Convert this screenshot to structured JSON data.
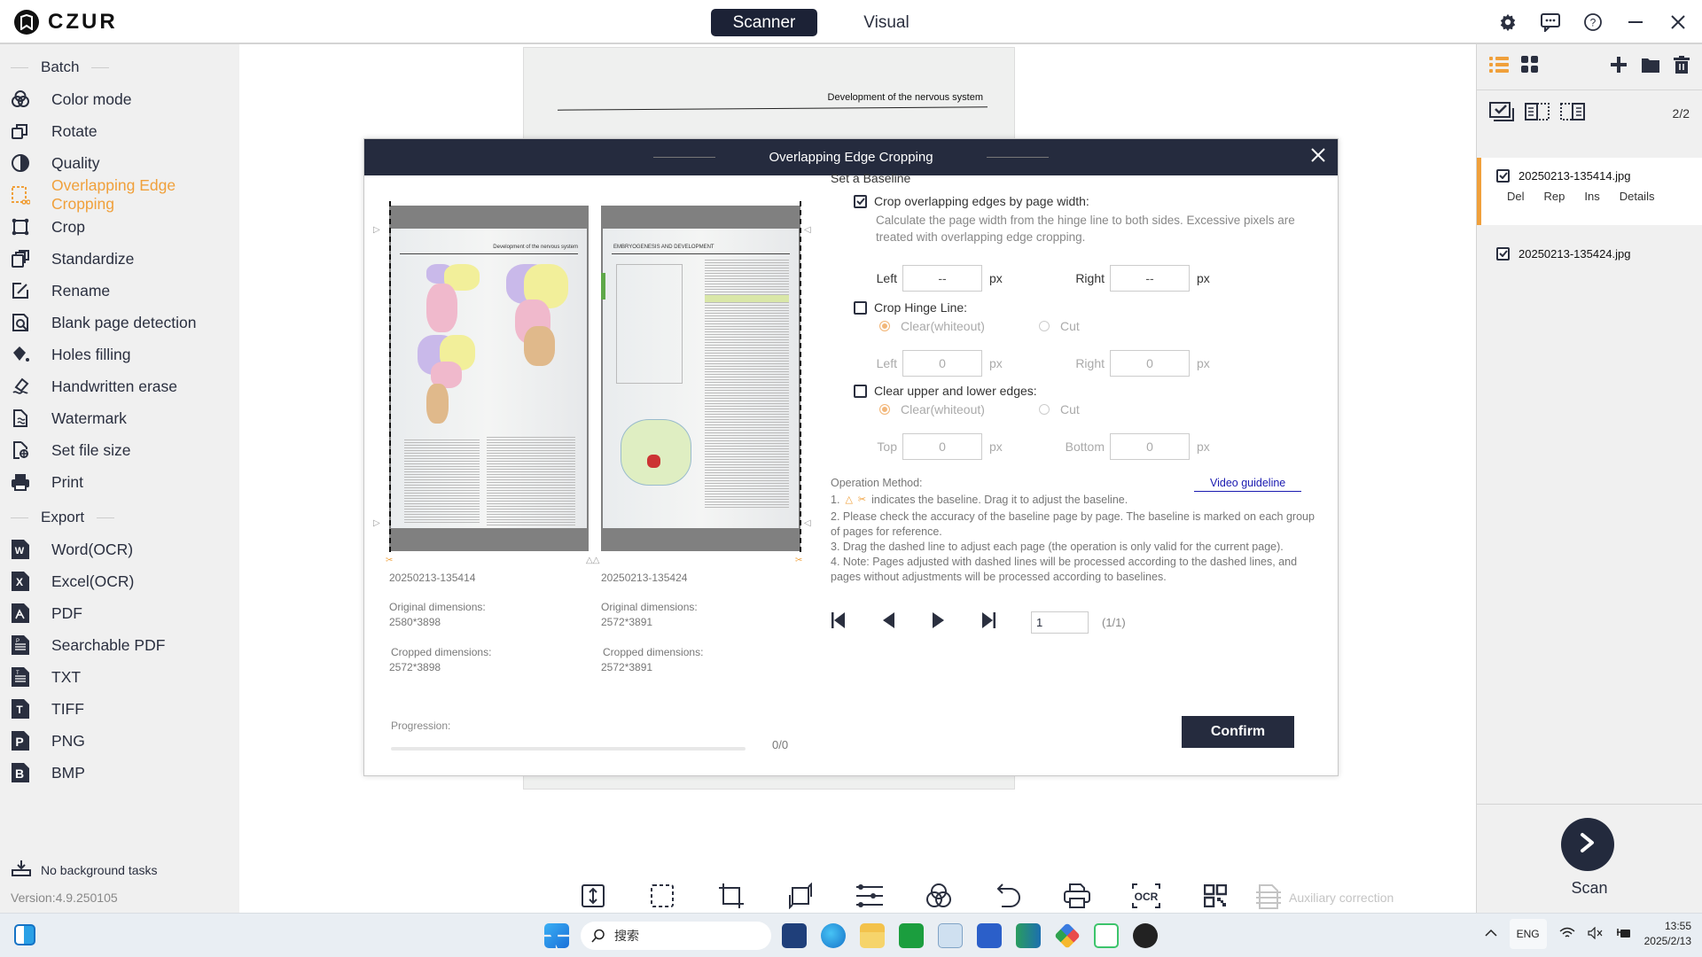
{
  "app": {
    "name": "CZUR"
  },
  "mode_tabs": [
    {
      "label": "Scanner",
      "active": true
    },
    {
      "label": "Visual",
      "active": false
    }
  ],
  "window_controls": [
    "settings-icon",
    "feedback-icon",
    "help-icon",
    "minimize-icon",
    "close-icon"
  ],
  "sidebar": {
    "batch_title": "Batch",
    "batch_items": [
      {
        "label": "Color mode",
        "icon": "color-mode-icon"
      },
      {
        "label": "Rotate",
        "icon": "rotate-icon"
      },
      {
        "label": "Quality",
        "icon": "quality-icon"
      },
      {
        "label": "Overlapping Edge Cropping",
        "icon": "overlapping-crop-icon",
        "active": true
      },
      {
        "label": "Crop",
        "icon": "crop-icon"
      },
      {
        "label": "Standardize",
        "icon": "standardize-icon"
      },
      {
        "label": "Rename",
        "icon": "rename-icon"
      },
      {
        "label": "Blank page detection",
        "icon": "blank-page-icon"
      },
      {
        "label": "Holes filling",
        "icon": "paint-bucket-icon"
      },
      {
        "label": "Handwritten erase",
        "icon": "eraser-icon"
      },
      {
        "label": "Watermark",
        "icon": "watermark-icon"
      },
      {
        "label": "Set file size",
        "icon": "file-size-icon"
      },
      {
        "label": "Print",
        "icon": "printer-icon"
      }
    ],
    "export_title": "Export",
    "export_items": [
      {
        "label": "Word(OCR)",
        "glyph": "W"
      },
      {
        "label": "Excel(OCR)",
        "glyph": "X"
      },
      {
        "label": "PDF",
        "glyph": "⅄"
      },
      {
        "label": "Searchable PDF",
        "glyph": "P"
      },
      {
        "label": "TXT",
        "glyph": "T"
      },
      {
        "label": "TIFF",
        "glyph": "T"
      },
      {
        "label": "PNG",
        "glyph": "P"
      },
      {
        "label": "BMP",
        "glyph": "B"
      }
    ],
    "background_tasks": "No background tasks",
    "version": "Version:4.9.250105"
  },
  "background_page": {
    "header": "Development of the nervous system"
  },
  "dialog": {
    "title": "Overlapping Edge Cropping",
    "pages": [
      {
        "name": "20250213-135414",
        "original_label": "Original dimensions:",
        "original": "2580*3898",
        "cropped_label": "Cropped dimensions:",
        "cropped": "2572*3898",
        "header": "Development of the nervous system"
      },
      {
        "name": "20250213-135424",
        "original_label": "Original dimensions:",
        "original": "2572*3891",
        "cropped_label": "Cropped dimensions:",
        "cropped": "2572*3891",
        "header": "EMBRYOGENESIS AND DEVELOPMENT"
      }
    ],
    "progression": {
      "label": "Progression:",
      "value": "0/0",
      "fraction": 0
    },
    "baseline_title": "Set a Baseline",
    "crop_by_width": {
      "label": "Crop overlapping edges by page width:",
      "checked": true,
      "description": "Calculate the page width from the hinge line to both sides. Excessive pixels are treated with overlapping edge cropping.",
      "left_label": "Left",
      "left_value": "--",
      "right_label": "Right",
      "right_value": "--",
      "unit": "px"
    },
    "crop_hinge": {
      "label": "Crop Hinge Line:",
      "checked": false,
      "options": [
        "Clear(whiteout)",
        "Cut"
      ],
      "selected": "Clear(whiteout)",
      "left_label": "Left",
      "left_value": "0",
      "right_label": "Right",
      "right_value": "0",
      "unit": "px"
    },
    "clear_edges": {
      "label": "Clear upper and lower edges:",
      "checked": false,
      "options": [
        "Clear(whiteout)",
        "Cut"
      ],
      "selected": "Clear(whiteout)",
      "top_label": "Top",
      "top_value": "0",
      "bottom_label": "Bottom",
      "bottom_value": "0",
      "unit": "px"
    },
    "operation": {
      "title": "Operation Method:",
      "video_link": "Video guideline",
      "step1_prefix": "1.",
      "step1": "indicates the baseline. Drag it to adjust the baseline.",
      "step2": "2. Please check the accuracy of the baseline page by page. The baseline is marked on each group of pages for reference.",
      "step3": "3. Drag the dashed line to adjust each page (the operation is only valid for the current page).",
      "step4": "4. Note: Pages adjusted with dashed lines will be processed according to the dashed lines, and pages without adjustments will be processed according to baselines."
    },
    "pager": {
      "current": "1",
      "count": "(1/1)"
    },
    "confirm_label": "Confirm"
  },
  "toolbar": {
    "items": [
      "page-height-icon",
      "select-region-icon",
      "crop-icon",
      "rotate-icon",
      "adjust-icon",
      "color-mode-icon",
      "undo-icon",
      "printer-icon",
      "ocr-icon",
      "qr-code-icon"
    ],
    "auxiliary_label": "Auxiliary correction"
  },
  "right_panel": {
    "count": "2/2",
    "files": [
      {
        "name": "20250213-135414.jpg",
        "checked": true,
        "selected": true,
        "actions": [
          "Del",
          "Rep",
          "Ins",
          "Details"
        ]
      },
      {
        "name": "20250213-135424.jpg",
        "checked": true,
        "selected": false
      }
    ],
    "scan_label": "Scan"
  },
  "taskbar": {
    "search_placeholder": "搜索",
    "language": "ENG",
    "time": "13:55",
    "date": "2025/2/13"
  },
  "colors": {
    "accent": "#f0a03b",
    "dark": "#252b3e"
  }
}
